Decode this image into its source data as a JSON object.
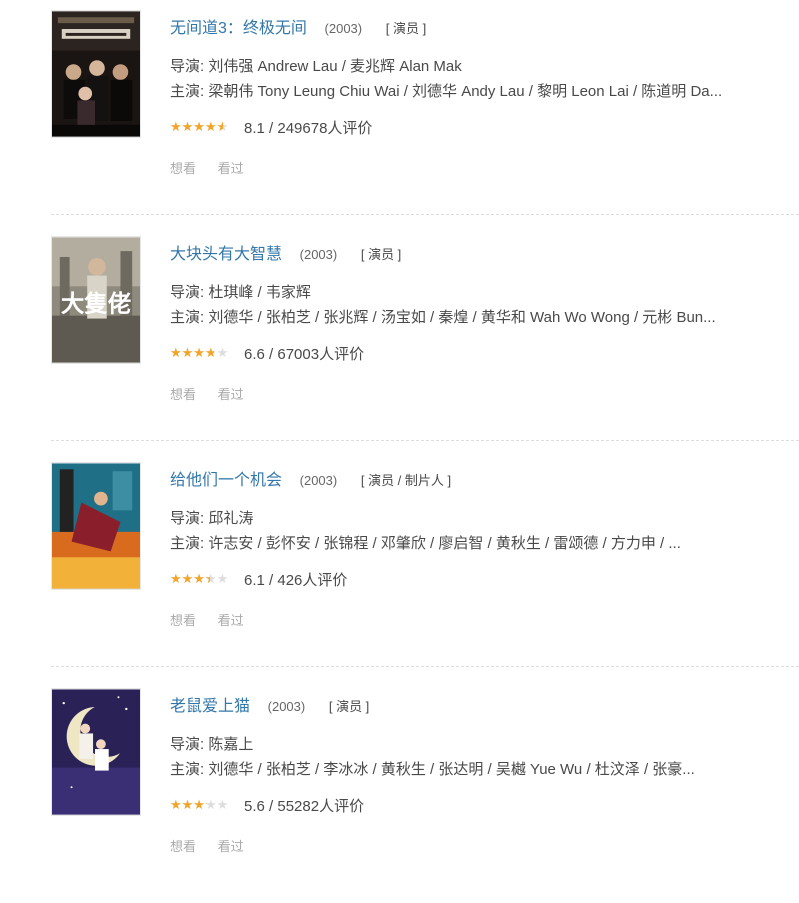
{
  "movies": [
    {
      "title": "无间道3：终极无间",
      "year": "(2003)",
      "roles": "[ 演员 ]",
      "director": "导演: 刘伟强 Andrew Lau / 麦兆辉 Alan Mak",
      "cast": "主演: 梁朝伟 Tony Leung Chiu Wai / 刘德华 Andy Lau / 黎明 Leon Lai / 陈道明 Da...",
      "rating_text": "8.1 / 249678人评价",
      "rating_value": 8.1,
      "want": "想看",
      "seen": "看过",
      "poster_icon": "movie-poster-infernal-affairs-3"
    },
    {
      "title": "大块头有大智慧",
      "year": "(2003)",
      "roles": "[ 演员 ]",
      "director": "导演: 杜琪峰 / 韦家辉",
      "cast": "主演: 刘德华 / 张柏芝 / 张兆辉 / 汤宝如 / 秦煌 / 黄华和 Wah Wo Wong / 元彬 Bun...",
      "rating_text": "6.6 / 67003人评价",
      "rating_value": 6.6,
      "want": "想看",
      "seen": "看过",
      "poster_icon": "movie-poster-running-on-karma",
      "poster_text": "大隻佬"
    },
    {
      "title": "给他们一个机会",
      "year": "(2003)",
      "roles": "[ 演员 / 制片人 ]",
      "director": "导演: 邱礼涛",
      "cast": "主演: 许志安 / 彭怀安 / 张锦程 / 邓肇欣 / 廖启智 / 黄秋生 / 雷颂德 / 方力申 / ...",
      "rating_text": "6.1 / 426人评价",
      "rating_value": 6.1,
      "want": "想看",
      "seen": "看过",
      "poster_icon": "movie-poster-give-them-a-chance"
    },
    {
      "title": "老鼠爱上猫",
      "year": "(2003)",
      "roles": "[ 演员 ]",
      "director": "导演: 陈嘉上",
      "cast": "主演: 刘德华 / 张柏芝 / 李冰冰 / 黄秋生 / 张达明 / 吴樾 Yue Wu / 杜汶泽 / 张豪...",
      "rating_text": "5.6 / 55282人评价",
      "rating_value": 5.6,
      "want": "想看",
      "seen": "看过",
      "poster_icon": "movie-poster-cat-and-mouse"
    }
  ],
  "colors": {
    "title_link": "#3377aa",
    "star_fill": "#f3a528",
    "star_empty": "#dddddd",
    "muted": "#aaaaaa"
  }
}
